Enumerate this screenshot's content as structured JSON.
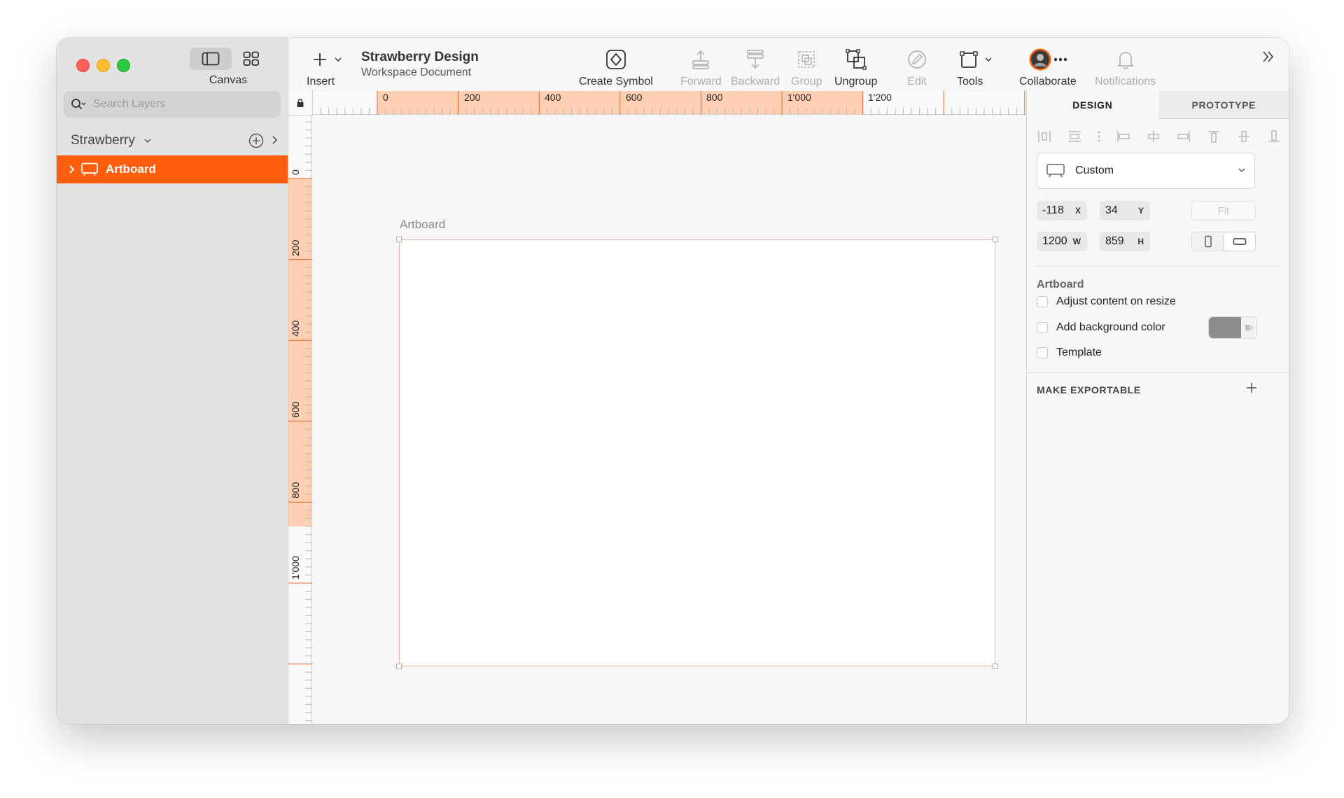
{
  "sidebar": {
    "view_label": "Canvas",
    "search_placeholder": "Search Layers",
    "page_name": "Strawberry",
    "layers": [
      {
        "label": "Artboard"
      }
    ]
  },
  "toolbar": {
    "insert_label": "Insert",
    "doc_title": "Strawberry Design",
    "doc_subtitle": "Workspace Document",
    "create_symbol_label": "Create Symbol",
    "forward_label": "Forward",
    "backward_label": "Backward",
    "group_label": "Group",
    "ungroup_label": "Ungroup",
    "edit_label": "Edit",
    "tools_label": "Tools",
    "collaborate_label": "Collaborate",
    "notifications_label": "Notifications"
  },
  "canvas": {
    "artboard_title": "Artboard",
    "ruler_top_labels": [
      "0",
      "200",
      "400",
      "600",
      "800",
      "1'000",
      "1'200"
    ],
    "ruler_left_labels": [
      "0",
      "200",
      "400",
      "600",
      "800",
      "1'000"
    ]
  },
  "inspector": {
    "tab_design": "DESIGN",
    "tab_prototype": "PROTOTYPE",
    "preset": "Custom",
    "x": "-118",
    "x_label": "X",
    "y": "34",
    "y_label": "Y",
    "w": "1200",
    "w_label": "W",
    "h": "859",
    "h_label": "H",
    "fit_label": "Fit",
    "section_title": "Artboard",
    "options": [
      {
        "label": "Adjust content on resize"
      },
      {
        "label": "Add background color"
      },
      {
        "label": "Template"
      }
    ],
    "export_title": "MAKE EXPORTABLE"
  },
  "colors": {
    "accent": "#ff5e0e",
    "ruler_highlight": "#ffcfb4",
    "artboard_border": "#f3b79b",
    "background_swatch": "#8c8c8c"
  },
  "icons": [
    "sidebar-toggle-icon",
    "grid-view-icon",
    "search-icon",
    "add-page-icon",
    "chevron-right-icon",
    "artboard-icon",
    "plus-icon",
    "chevron-down-icon",
    "symbol-icon",
    "forward-icon",
    "backward-icon",
    "group-icon",
    "ungroup-icon",
    "edit-icon",
    "tools-icon",
    "avatar",
    "more-icon",
    "bell-icon",
    "double-chevron-icon",
    "lock-icon",
    "align-icons",
    "portrait-icon",
    "landscape-icon"
  ]
}
